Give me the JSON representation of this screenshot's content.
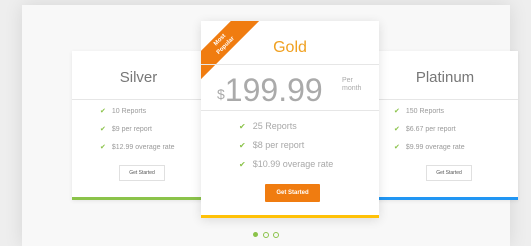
{
  "plans": {
    "silver": {
      "title": "Silver",
      "features": [
        "10 Reports",
        "$9 per report",
        "$12.99 overage rate"
      ],
      "button": "Get Started"
    },
    "gold": {
      "ribbon_line1": "Most",
      "ribbon_line2": "Popular",
      "title": "Gold",
      "currency": "$",
      "price": "199.99",
      "per_line1": "Per",
      "per_line2": "month",
      "features": [
        "25 Reports",
        "$8 per report",
        "$10.99 overage rate"
      ],
      "button": "Get Started"
    },
    "platinum": {
      "title": "Platinum",
      "features": [
        "150 Reports",
        "$6.67 per report",
        "$9.99 overage rate"
      ],
      "button": "Get Started"
    }
  },
  "carousel": {
    "page_count": 3,
    "active_page": 1
  },
  "colors": {
    "silver_accent": "#8bc34a",
    "gold_accent": "#ffc107",
    "platinum_accent": "#2196f3",
    "ribbon": "#f07c10",
    "check": "#8bc34a"
  }
}
